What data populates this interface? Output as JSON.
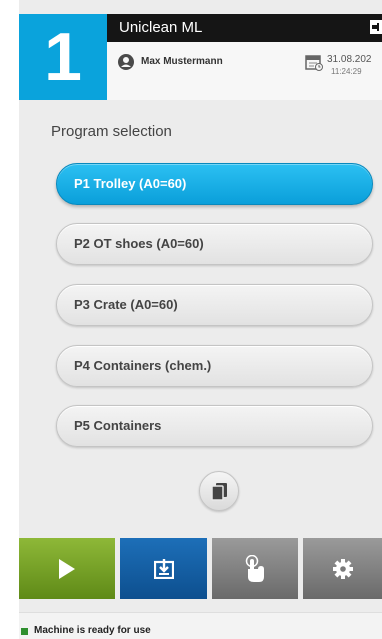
{
  "header": {
    "program_number": "1",
    "machine_name": "Uniclean ML",
    "user_name": "Max Mustermann",
    "date": "31.08.202",
    "time": "11:24:29"
  },
  "program_selection": {
    "title": "Program selection",
    "programs": [
      {
        "label": "P1 Trolley (A0=60)",
        "selected": true
      },
      {
        "label": "P2 OT shoes (A0=60)",
        "selected": false
      },
      {
        "label": "P3 Crate (A0=60)",
        "selected": false
      },
      {
        "label": "P4 Containers (chem.)",
        "selected": false
      },
      {
        "label": "P5 Containers",
        "selected": false
      }
    ],
    "copy_icon": "copy-icon"
  },
  "action_bar": {
    "buttons": [
      {
        "name": "start",
        "icon": "play-icon",
        "color": "#76a227"
      },
      {
        "name": "load",
        "icon": "download-tray-icon",
        "color": "#15609f"
      },
      {
        "name": "touch",
        "icon": "hand-pointer-icon",
        "color": "#858585"
      },
      {
        "name": "settings",
        "icon": "gear-icon",
        "color": "#858585"
      }
    ]
  },
  "status": {
    "text": "Machine is ready for use",
    "indicator_color": "#2f8f2f"
  },
  "colors": {
    "accent": "#0aa3dc",
    "header_bar": "#151515"
  }
}
